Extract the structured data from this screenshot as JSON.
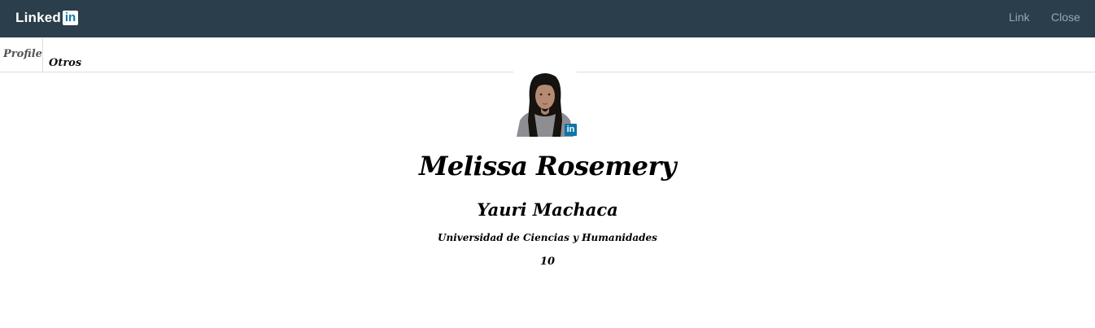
{
  "navbar": {
    "brand_text": "Linked",
    "brand_badge": "in",
    "links": [
      {
        "label": "Link"
      },
      {
        "label": "Close"
      }
    ],
    "background_color": "#2a3e4b"
  },
  "tabs": [
    {
      "label": "Profile",
      "active": true
    },
    {
      "label": "Otros",
      "active": false
    }
  ],
  "profile": {
    "avatar_badge": "in",
    "first_name": "Melissa Rosemery",
    "last_name": "Yauri Machaca",
    "university": "Universidad de Ciencias y Humanidades",
    "number": "10"
  },
  "colors": {
    "linkedin_blue": "#0e76a8"
  }
}
